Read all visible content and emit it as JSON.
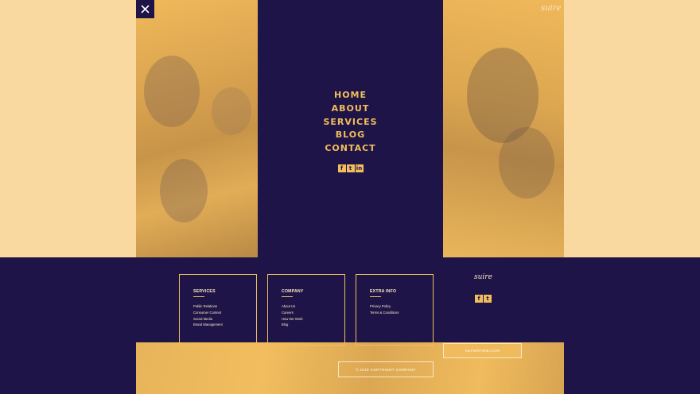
{
  "brand": {
    "logo_text": "suire"
  },
  "close": {
    "icon": "close-icon"
  },
  "menu": {
    "items": [
      {
        "label": "HOME"
      },
      {
        "label": "ABOUT"
      },
      {
        "label": "SERVICES"
      },
      {
        "label": "BLOG"
      },
      {
        "label": "CONTACT"
      }
    ],
    "social": [
      {
        "icon": "facebook-icon",
        "glyph": "f"
      },
      {
        "icon": "twitter-icon",
        "glyph": "t"
      },
      {
        "icon": "linkedin-icon",
        "glyph": "in"
      }
    ]
  },
  "footer": {
    "columns": [
      {
        "title": "SERVICES",
        "links": [
          "Public Relations",
          "Consumer Content",
          "Social Media",
          "Brand Management"
        ]
      },
      {
        "title": "COMPANY",
        "links": [
          "About Us",
          "Careers",
          "How We Work",
          "Blog"
        ]
      },
      {
        "title": "EXTRA INFO",
        "links": [
          "Privacy Policy",
          "Terms & Conditions"
        ]
      }
    ],
    "brand": "suire",
    "social": [
      {
        "icon": "facebook-icon",
        "glyph": "f"
      },
      {
        "icon": "twitter-icon",
        "glyph": "t"
      }
    ],
    "email": "SUPERFIRM.COM",
    "copyright": "© 2019 COPYRIGHT COMPANY"
  },
  "colors": {
    "navy": "#1e1447",
    "gold": "#f2be5c",
    "cream": "#fad9a1"
  }
}
